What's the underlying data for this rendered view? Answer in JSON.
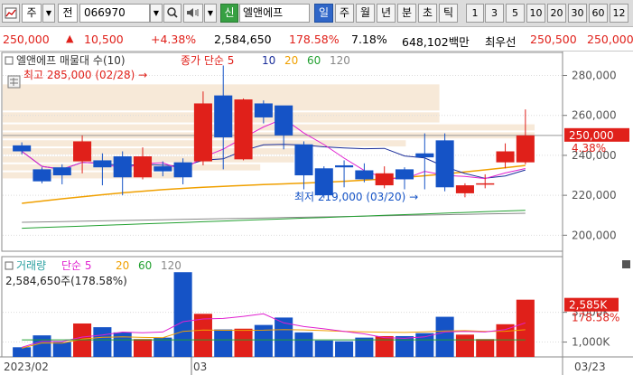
{
  "toolbar": {
    "chart_icon": "chart-icon",
    "type_label": "주",
    "prefix_label": "전",
    "code_value": "066970",
    "new_badge": "신",
    "stock_name": "엘앤에프",
    "periods": [
      "일",
      "주",
      "월",
      "년",
      "분",
      "초",
      "틱"
    ],
    "active_period": "일",
    "numbers": [
      "1",
      "3",
      "5",
      "10",
      "20",
      "30",
      "60",
      "12"
    ]
  },
  "quote": {
    "price": "250,000",
    "change": "10,500",
    "change_pct": "+4.38%",
    "volume": "2,584,650",
    "volume_ratio": "178.58%",
    "turnover": "7.18%",
    "amount": "648,102백만",
    "best_label": "최우선",
    "ask": "250,500",
    "bid": "250,000"
  },
  "colors": {
    "up": "#e0201a",
    "down": "#1553c6",
    "ma5": "#e020d0",
    "ma10": "#1a2d9a",
    "ma20": "#f0a000",
    "ma60": "#22a030",
    "ma120": "#888888"
  },
  "price_panel": {
    "legend_title": "엘앤에프 매물대 수(10)",
    "legend_ma": "종가 단순",
    "ma_periods": [
      "5",
      "10",
      "20",
      "60",
      "120"
    ],
    "high_label": "최고 285,000 (02/28)",
    "low_label": "최저 219,000 (03/20)",
    "last_price_tag": "250,000",
    "last_pct_tag": "4.38%",
    "y_ticks": [
      "280,000",
      "260,000",
      "240,000",
      "220,000",
      "200,000"
    ]
  },
  "volume_panel": {
    "legend_title": "거래량",
    "legend_ma": "단순",
    "ma_periods": [
      "5",
      "20",
      "60",
      "120"
    ],
    "current_label": "2,584,650주(178.58%)",
    "last_vol_tag": "2,585K",
    "last_pct_tag": "178.58%",
    "y_ticks": [
      "3,000K",
      "1,000K"
    ]
  },
  "x_labels": [
    "2023/02",
    "03",
    "03/23"
  ],
  "chart_data": {
    "type": "candlestick",
    "dates": [
      "02/14",
      "02/15",
      "02/16",
      "02/17",
      "02/20",
      "02/21",
      "02/22",
      "02/23",
      "02/24",
      "02/27",
      "02/28",
      "03/02",
      "03/03",
      "03/06",
      "03/07",
      "03/08",
      "03/09",
      "03/10",
      "03/13",
      "03/14",
      "03/15",
      "03/16",
      "03/17",
      "03/20",
      "03/21",
      "03/22",
      "03/23"
    ],
    "open": [
      245000,
      233000,
      234000,
      237000,
      237500,
      239500,
      229000,
      234500,
      236500,
      237000,
      270000,
      238000,
      266000,
      265000,
      245500,
      233500,
      235000,
      232500,
      225000,
      233000,
      241000,
      247500,
      221000,
      225500,
      236500,
      236500
    ],
    "close": [
      242000,
      227000,
      230000,
      247000,
      234000,
      229000,
      239500,
      232000,
      229000,
      266000,
      249000,
      268000,
      259000,
      250000,
      230000,
      220000,
      234000,
      228000,
      231000,
      228000,
      239000,
      224000,
      225000,
      226000,
      242000,
      250000
    ],
    "high": [
      246500,
      234000,
      235500,
      250000,
      241000,
      242000,
      244000,
      237000,
      238500,
      272000,
      285000,
      268500,
      267500,
      251000,
      247000,
      234500,
      237500,
      236000,
      234500,
      234000,
      251000,
      251000,
      226000,
      230500,
      246000,
      263000
    ],
    "low": [
      240500,
      226000,
      225500,
      231000,
      225000,
      220000,
      228000,
      229500,
      225500,
      235000,
      233000,
      237500,
      256000,
      243000,
      223000,
      218500,
      224000,
      226500,
      223500,
      223000,
      223000,
      222000,
      219000,
      223500,
      233500,
      235500
    ],
    "volume": [
      650,
      1450,
      1000,
      2250,
      2000,
      1650,
      1200,
      1300,
      5700,
      2900,
      1850,
      1900,
      2150,
      2650,
      1650,
      1100,
      1050,
      1300,
      1400,
      1400,
      1600,
      2700,
      1500,
      1200,
      2200,
      3850
    ],
    "ylim": [
      192000,
      292000
    ],
    "volume_ylim": [
      0,
      6200
    ]
  }
}
